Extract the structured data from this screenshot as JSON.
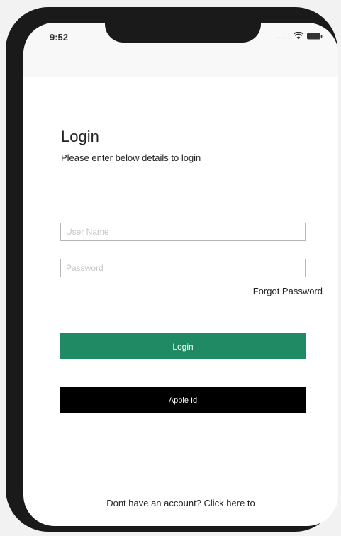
{
  "status_bar": {
    "time": "9:52",
    "signal_text": "....."
  },
  "login": {
    "title": "Login",
    "subtitle": "Please enter below details to login",
    "username_placeholder": "User Name",
    "password_placeholder": "Password",
    "forgot_password": "Forgot Password",
    "login_button": "Login",
    "apple_button": "Apple Id",
    "signup_text": "Dont have an account? Click here to"
  },
  "colors": {
    "login_button": "#1f8a63",
    "apple_button": "#000000",
    "phone_frame": "#1a1a1a"
  },
  "icons": {
    "wifi": "wifi-icon",
    "battery": "battery-icon"
  }
}
